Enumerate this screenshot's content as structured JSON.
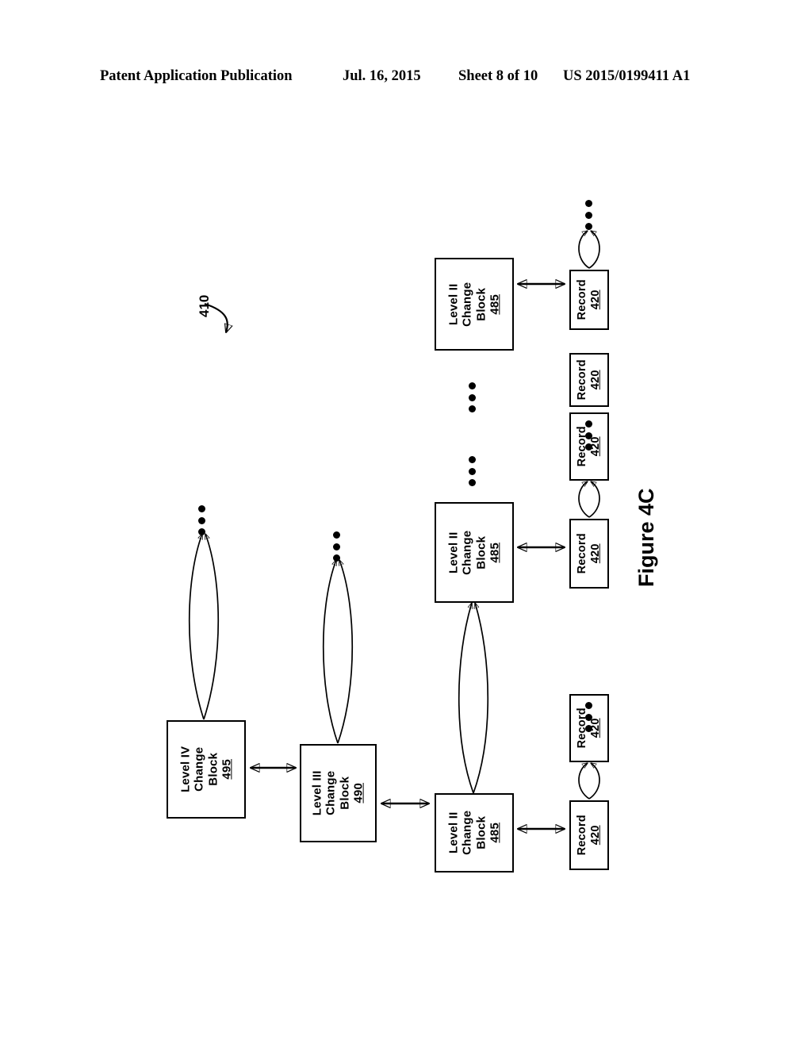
{
  "header": {
    "publication": "Patent Application Publication",
    "date": "Jul. 16, 2015",
    "sheet": "Sheet 8 of 10",
    "number": "US 2015/0199411 A1"
  },
  "figure": {
    "caption": "Figure 4C",
    "reference_numeral": "410"
  },
  "blocks": {
    "level4": {
      "line1": "Level IV",
      "line2": "Change",
      "line3": "Block",
      "num": "495"
    },
    "level3": {
      "line1": "Level III",
      "line2": "Change",
      "line3": "Block",
      "num": "490"
    },
    "level2_bottom": {
      "line1": "Level II",
      "line2": "Change",
      "line3": "Block",
      "num": "485"
    },
    "level2_middle": {
      "line1": "Level II",
      "line2": "Change",
      "line3": "Block",
      "num": "485"
    },
    "level2_top": {
      "line1": "Level II",
      "line2": "Change",
      "line3": "Block",
      "num": "485"
    }
  },
  "records": {
    "label": "Record",
    "num": "420",
    "items": [
      {
        "id": "record-1",
        "label": "Record",
        "num": "420"
      },
      {
        "id": "record-2",
        "label": "Record",
        "num": "420"
      },
      {
        "id": "record-3",
        "label": "Record",
        "num": "420"
      },
      {
        "id": "record-4",
        "label": "Record",
        "num": "420"
      },
      {
        "id": "record-5",
        "label": "Record",
        "num": "420"
      },
      {
        "id": "record-6",
        "label": "Record",
        "num": "420"
      }
    ]
  },
  "colors": {
    "line": "#000000",
    "background": "#ffffff"
  }
}
